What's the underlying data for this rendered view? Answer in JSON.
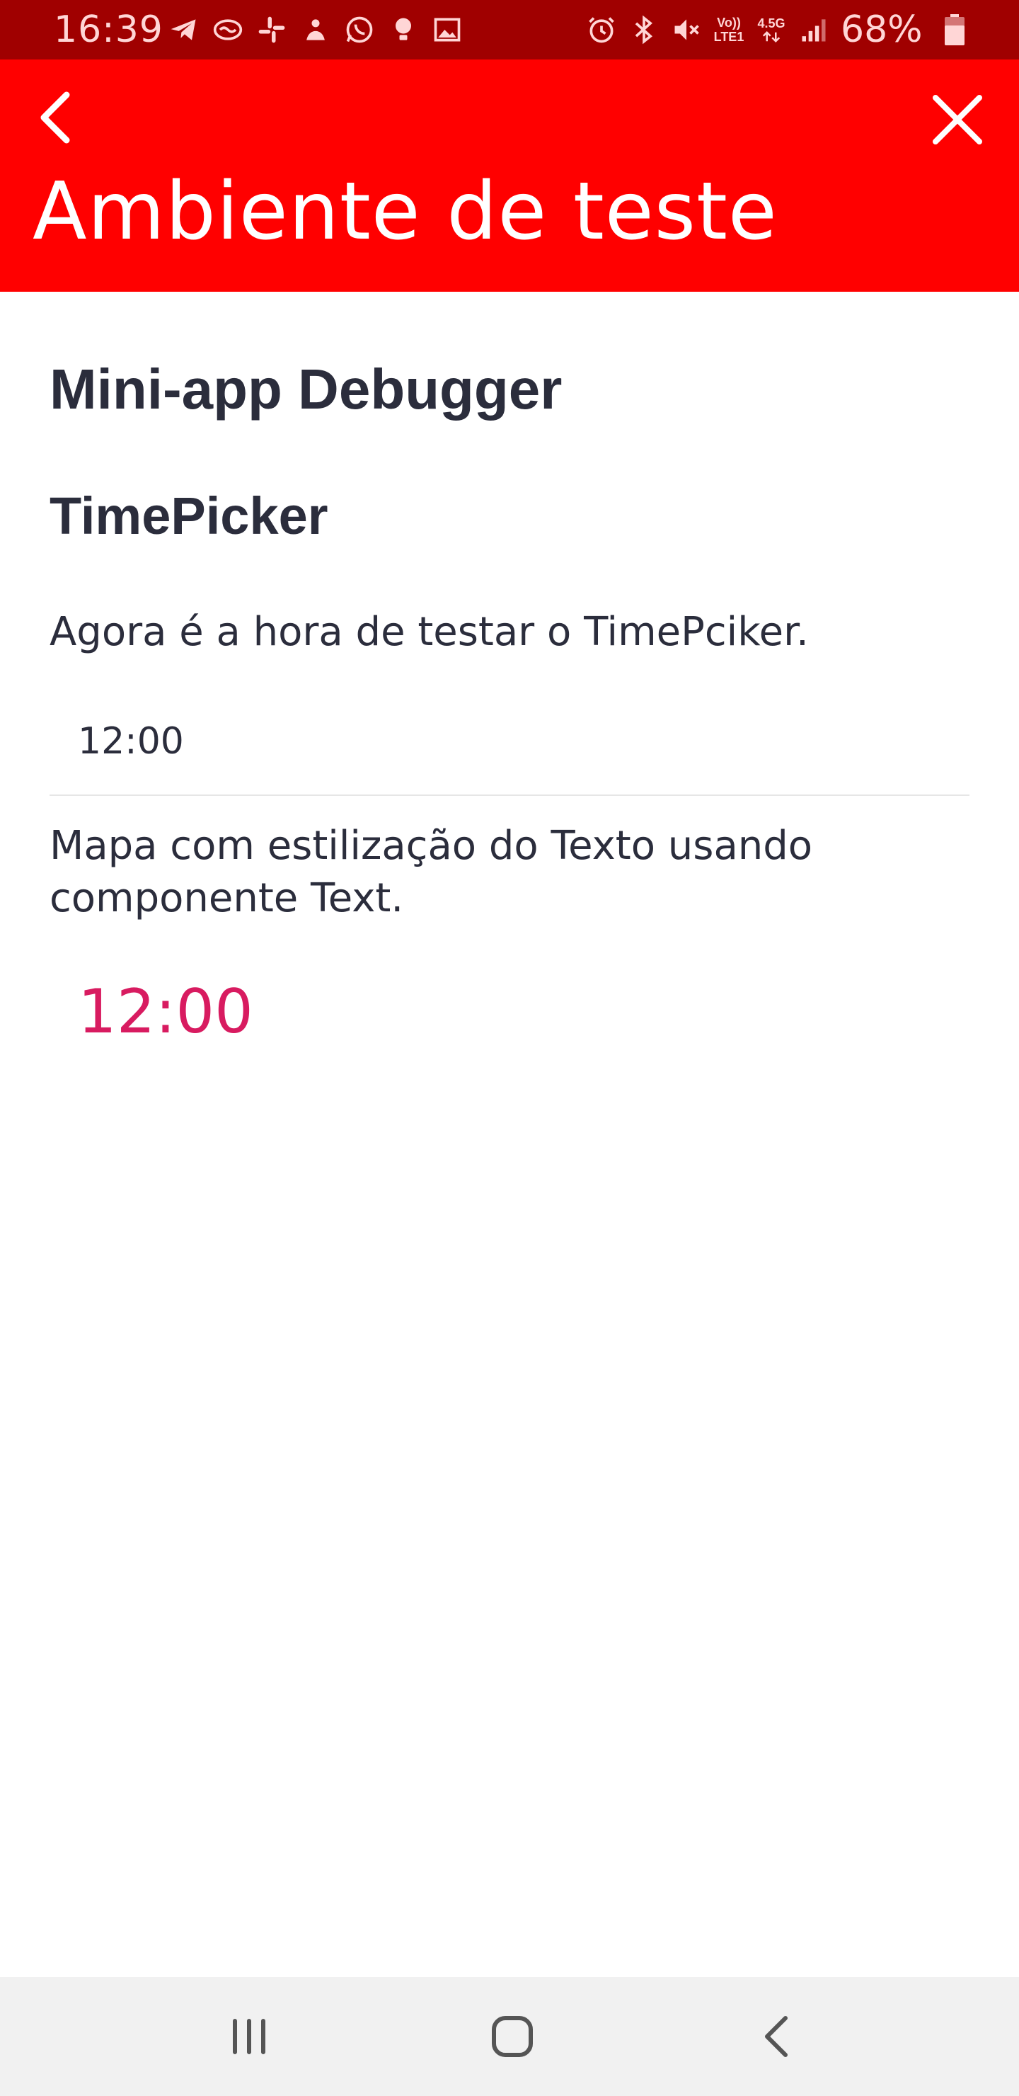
{
  "status_bar": {
    "time": "16:39",
    "battery_percent": "68%",
    "network_volte": "Vo))",
    "network_lte": "LTE1",
    "network_gen": "4.5G",
    "notification_icons": [
      "telegram-icon",
      "handshake-icon",
      "slack-icon",
      "sync-icon",
      "whatsapp-icon",
      "bulb-icon",
      "gallery-icon"
    ],
    "system_icons": [
      "alarm-icon",
      "bluetooth-icon",
      "mute-icon",
      "signal-icon",
      "battery-icon"
    ]
  },
  "header": {
    "title": "Ambiente de teste",
    "background_color": "#ff0000",
    "back_icon": "chevron-left-icon",
    "close_icon": "close-icon"
  },
  "content": {
    "app_title": "Mini-app Debugger",
    "section_title": "TimePicker",
    "description_timepicker": "Agora é a hora de testar o TimePciker.",
    "timepicker_value": "12:00",
    "description_text": "Mapa com estilização do Texto usando componente Text.",
    "styled_time_value": "12:00",
    "styled_time_color": "#d81b60"
  },
  "nav_bar": {
    "recents_icon": "recents-icon",
    "home_icon": "home-icon",
    "back_icon": "back-icon"
  }
}
